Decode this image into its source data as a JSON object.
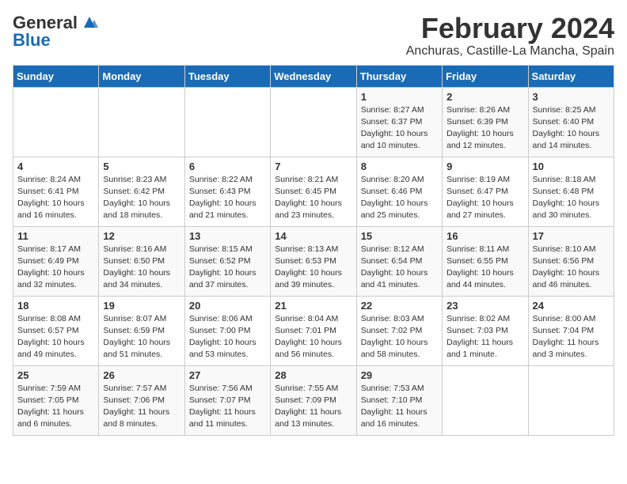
{
  "logo": {
    "general": "General",
    "blue": "Blue"
  },
  "title": {
    "month": "February 2024",
    "location": "Anchuras, Castille-La Mancha, Spain"
  },
  "headers": [
    "Sunday",
    "Monday",
    "Tuesday",
    "Wednesday",
    "Thursday",
    "Friday",
    "Saturday"
  ],
  "weeks": [
    [
      {
        "day": "",
        "info": ""
      },
      {
        "day": "",
        "info": ""
      },
      {
        "day": "",
        "info": ""
      },
      {
        "day": "",
        "info": ""
      },
      {
        "day": "1",
        "info": "Sunrise: 8:27 AM\nSunset: 6:37 PM\nDaylight: 10 hours\nand 10 minutes."
      },
      {
        "day": "2",
        "info": "Sunrise: 8:26 AM\nSunset: 6:39 PM\nDaylight: 10 hours\nand 12 minutes."
      },
      {
        "day": "3",
        "info": "Sunrise: 8:25 AM\nSunset: 6:40 PM\nDaylight: 10 hours\nand 14 minutes."
      }
    ],
    [
      {
        "day": "4",
        "info": "Sunrise: 8:24 AM\nSunset: 6:41 PM\nDaylight: 10 hours\nand 16 minutes."
      },
      {
        "day": "5",
        "info": "Sunrise: 8:23 AM\nSunset: 6:42 PM\nDaylight: 10 hours\nand 18 minutes."
      },
      {
        "day": "6",
        "info": "Sunrise: 8:22 AM\nSunset: 6:43 PM\nDaylight: 10 hours\nand 21 minutes."
      },
      {
        "day": "7",
        "info": "Sunrise: 8:21 AM\nSunset: 6:45 PM\nDaylight: 10 hours\nand 23 minutes."
      },
      {
        "day": "8",
        "info": "Sunrise: 8:20 AM\nSunset: 6:46 PM\nDaylight: 10 hours\nand 25 minutes."
      },
      {
        "day": "9",
        "info": "Sunrise: 8:19 AM\nSunset: 6:47 PM\nDaylight: 10 hours\nand 27 minutes."
      },
      {
        "day": "10",
        "info": "Sunrise: 8:18 AM\nSunset: 6:48 PM\nDaylight: 10 hours\nand 30 minutes."
      }
    ],
    [
      {
        "day": "11",
        "info": "Sunrise: 8:17 AM\nSunset: 6:49 PM\nDaylight: 10 hours\nand 32 minutes."
      },
      {
        "day": "12",
        "info": "Sunrise: 8:16 AM\nSunset: 6:50 PM\nDaylight: 10 hours\nand 34 minutes."
      },
      {
        "day": "13",
        "info": "Sunrise: 8:15 AM\nSunset: 6:52 PM\nDaylight: 10 hours\nand 37 minutes."
      },
      {
        "day": "14",
        "info": "Sunrise: 8:13 AM\nSunset: 6:53 PM\nDaylight: 10 hours\nand 39 minutes."
      },
      {
        "day": "15",
        "info": "Sunrise: 8:12 AM\nSunset: 6:54 PM\nDaylight: 10 hours\nand 41 minutes."
      },
      {
        "day": "16",
        "info": "Sunrise: 8:11 AM\nSunset: 6:55 PM\nDaylight: 10 hours\nand 44 minutes."
      },
      {
        "day": "17",
        "info": "Sunrise: 8:10 AM\nSunset: 6:56 PM\nDaylight: 10 hours\nand 46 minutes."
      }
    ],
    [
      {
        "day": "18",
        "info": "Sunrise: 8:08 AM\nSunset: 6:57 PM\nDaylight: 10 hours\nand 49 minutes."
      },
      {
        "day": "19",
        "info": "Sunrise: 8:07 AM\nSunset: 6:59 PM\nDaylight: 10 hours\nand 51 minutes."
      },
      {
        "day": "20",
        "info": "Sunrise: 8:06 AM\nSunset: 7:00 PM\nDaylight: 10 hours\nand 53 minutes."
      },
      {
        "day": "21",
        "info": "Sunrise: 8:04 AM\nSunset: 7:01 PM\nDaylight: 10 hours\nand 56 minutes."
      },
      {
        "day": "22",
        "info": "Sunrise: 8:03 AM\nSunset: 7:02 PM\nDaylight: 10 hours\nand 58 minutes."
      },
      {
        "day": "23",
        "info": "Sunrise: 8:02 AM\nSunset: 7:03 PM\nDaylight: 11 hours\nand 1 minute."
      },
      {
        "day": "24",
        "info": "Sunrise: 8:00 AM\nSunset: 7:04 PM\nDaylight: 11 hours\nand 3 minutes."
      }
    ],
    [
      {
        "day": "25",
        "info": "Sunrise: 7:59 AM\nSunset: 7:05 PM\nDaylight: 11 hours\nand 6 minutes."
      },
      {
        "day": "26",
        "info": "Sunrise: 7:57 AM\nSunset: 7:06 PM\nDaylight: 11 hours\nand 8 minutes."
      },
      {
        "day": "27",
        "info": "Sunrise: 7:56 AM\nSunset: 7:07 PM\nDaylight: 11 hours\nand 11 minutes."
      },
      {
        "day": "28",
        "info": "Sunrise: 7:55 AM\nSunset: 7:09 PM\nDaylight: 11 hours\nand 13 minutes."
      },
      {
        "day": "29",
        "info": "Sunrise: 7:53 AM\nSunset: 7:10 PM\nDaylight: 11 hours\nand 16 minutes."
      },
      {
        "day": "",
        "info": ""
      },
      {
        "day": "",
        "info": ""
      }
    ]
  ]
}
